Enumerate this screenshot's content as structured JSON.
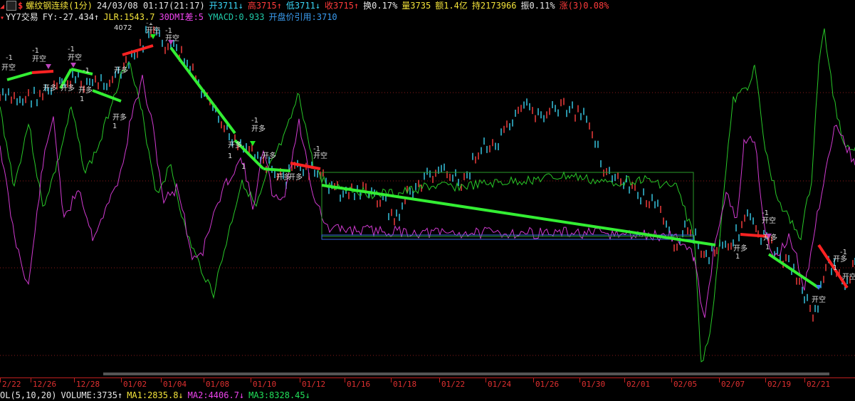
{
  "header": {
    "icon_symbol": "$",
    "title": "螺纹钢连续(1分)",
    "datetime": "24/03/08 01:17(21:17)",
    "quotes": [
      {
        "text": "开3711",
        "arrow": "↓",
        "color": "#39d5f5"
      },
      {
        "text": "高3715",
        "arrow": "↑",
        "color": "#ff3b3b"
      },
      {
        "text": "低3711",
        "arrow": "↓",
        "color": "#39d5f5"
      },
      {
        "text": "收3715",
        "arrow": "↑",
        "color": "#ff3b3b"
      },
      {
        "text": "换0.17%",
        "arrow": "",
        "color": "#e8e8e8"
      },
      {
        "text": "量3735",
        "arrow": "",
        "color": "#f2e23a"
      },
      {
        "text": "额1.4亿",
        "arrow": "",
        "color": "#f2e23a"
      },
      {
        "text": "持2173966",
        "arrow": "",
        "color": "#f2e23a"
      },
      {
        "text": "振0.11%",
        "arrow": "",
        "color": "#e8e8e8"
      },
      {
        "text": "涨(3)0.08%",
        "arrow": "",
        "color": "#ff3b3b"
      }
    ]
  },
  "indicator": {
    "name": "YY7交易",
    "items": [
      {
        "text": "FY:-27.434",
        "arrow": "↑",
        "color": "#e8e8e8"
      },
      {
        "text": "JLR:1543.7",
        "arrow": "",
        "color": "#f2e23a"
      },
      {
        "text": "30DMI差:5",
        "arrow": "",
        "color": "#ee44ee"
      },
      {
        "text": "YMACD:0.933",
        "arrow": "",
        "color": "#20c8a8"
      },
      {
        "text": "开盘价引用:3710",
        "arrow": "",
        "color": "#3a9cf0"
      }
    ]
  },
  "volume": {
    "prefix": "OL(5,10,20)",
    "items": [
      {
        "text": "VOLUME:3735",
        "arrow": "↑",
        "color": "#e8e8e8"
      },
      {
        "text": "MA1:2835.8",
        "arrow": "↓",
        "color": "#f2e23a"
      },
      {
        "text": "MA2:4406.7",
        "arrow": "↓",
        "color": "#ee44ee"
      },
      {
        "text": "MA3:8328.45",
        "arrow": "↓",
        "color": "#22e05a"
      }
    ]
  },
  "annotations": {
    "peak_label": "4072",
    "open_short": "开空",
    "open_long": "开多",
    "minus_one": "-1",
    "one": "1"
  },
  "date_axis": [
    "2/22",
    "12/26",
    "12/28",
    "01/02",
    "01/04",
    "01/08",
    "01/10",
    "01/12",
    "01/16",
    "01/18",
    "01/22",
    "01/24",
    "01/26",
    "01/30",
    "02/01",
    "02/05",
    "02/07",
    "02/19",
    "02/21"
  ]
}
